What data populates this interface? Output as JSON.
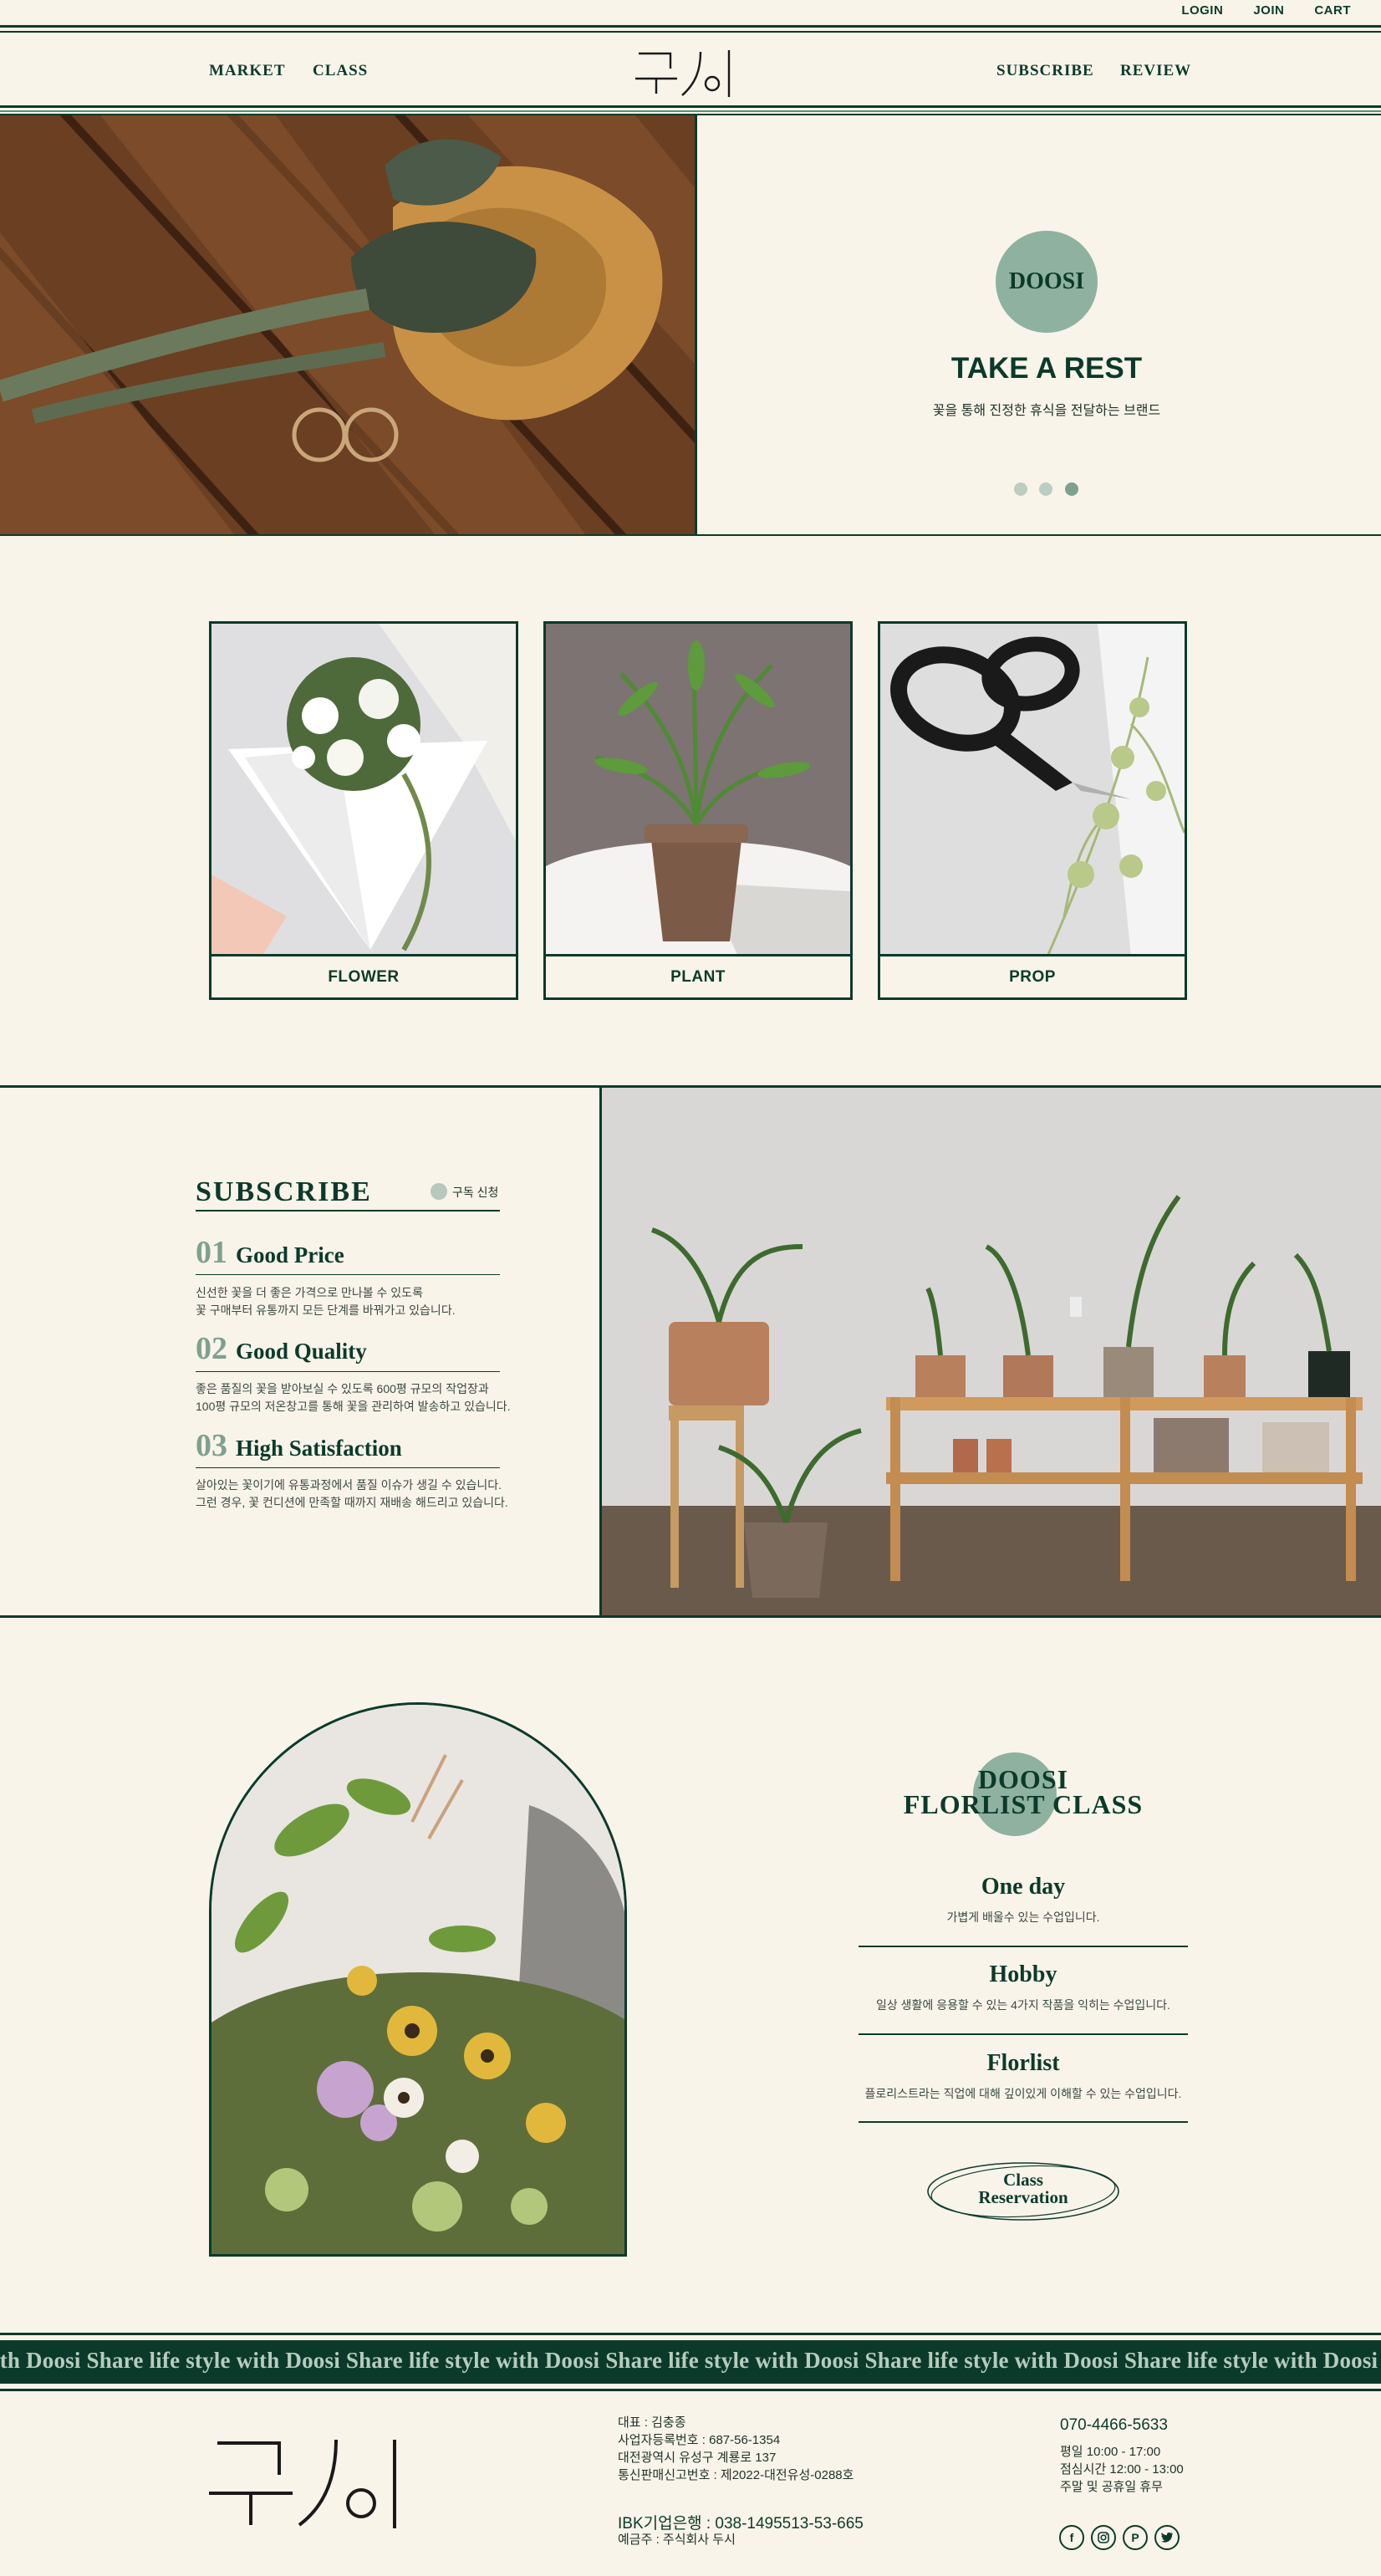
{
  "top_links": {
    "login": "LOGIN",
    "join": "JOIN",
    "cart": "CART"
  },
  "nav": {
    "market": "MARKET",
    "class": "CLASS",
    "subscribe": "SUBSCRIBE",
    "review": "REVIEW"
  },
  "logo": "두시",
  "hero": {
    "badge": "DOOSI",
    "title": "TAKE A REST",
    "subtitle": "꽃을 통해 진정한 휴식을 전달하는 브랜드",
    "slides_total": 3,
    "active_slide": 3
  },
  "categories": [
    {
      "label": "FLOWER"
    },
    {
      "label": "PLANT"
    },
    {
      "label": "PROP"
    }
  ],
  "subscribe": {
    "title": "SUBSCRIBE",
    "cta": "구독 신청",
    "features": [
      {
        "num": "01",
        "title": "Good Price",
        "desc1": "신선한 꽃을 더 좋은 가격으로 만나볼 수 있도록",
        "desc2": "꽃 구매부터 유통까지 모든 단계를 바꿔가고 있습니다."
      },
      {
        "num": "02",
        "title": "Good Quality",
        "desc1": "좋은 품질의 꽃을 받아보실 수 있도록 600평 규모의 작업장과",
        "desc2": "100평 규모의 저온창고를 통해 꽃을 관리하여 발송하고 있습니다."
      },
      {
        "num": "03",
        "title": "High Satisfaction",
        "desc1": "살아있는 꽃이기에 유통과정에서 품질 이슈가 생길 수 있습니다.",
        "desc2": "그런 경우, 꽃 컨디션에 만족할 때까지 재배송 해드리고 있습니다."
      }
    ]
  },
  "florist_class": {
    "title_line1": "DOOSI",
    "title_line2": "FLORLIST CLASS",
    "items": [
      {
        "title": "One day",
        "desc": "가볍게 배울수 있는 수업입니다."
      },
      {
        "title": "Hobby",
        "desc": "일상 생활에 응용할 수 있는 4가지 작품을 익히는 수업입니다."
      },
      {
        "title": "Florlist",
        "desc": "플로리스트라는 직업에 대해 깊이있게 이해할 수 있는 수업입니다."
      }
    ],
    "reservation_line1": "Class",
    "reservation_line2": "Reservation"
  },
  "marquee": "ith Doosi Share life style with Doosi Share life style with Doosi Share life style with Doosi Share life style with Doosi Share life style with Doosi Share life style wit",
  "footer": {
    "ceo": "대표 : 김충종",
    "biz_no": "사업자등록번호 : 687-56-1354",
    "address": "대전광역시 유성구 계룡로 137",
    "mail_order": "통신판매신고번호 : 제2022-대전유성-0288호",
    "bank": "IBK기업은행 : 038-1495513-53-665",
    "holder": "예금주 : 주식회사 두시",
    "phone": "070-4466-5633",
    "hours": "평일 10:00 - 17:00",
    "lunch": "점심시간 12:00 - 13:00",
    "closed": "주말 및 공휴일 휴무"
  },
  "icons": [
    "facebook-icon",
    "instagram-icon",
    "pinterest-icon",
    "twitter-icon"
  ],
  "colors": {
    "background": "#f8f4ea",
    "primary": "#0c3a2a",
    "accent": "#8fb1a0"
  }
}
